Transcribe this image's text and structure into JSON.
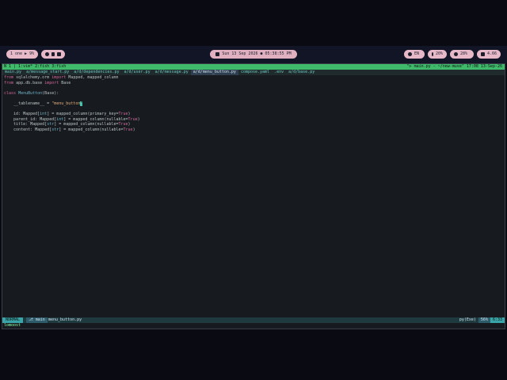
{
  "panel": {
    "workspace_label": "1 one ▶ 9%",
    "clock": "Sun 13 Sep 2026 ● 05:38:55 PM",
    "indicators": [
      "EN",
      "20%",
      "28%",
      "4.66"
    ]
  },
  "tmux": {
    "left": "N 1 | 1:vim* 2:fish 3:fish",
    "right": "\"⊳ main.py - ~/new-muse\" 17:08 13-Sep-26"
  },
  "tabs": [
    {
      "label": "main.py",
      "active": false
    },
    {
      "label": "a/message_start.py",
      "active": false
    },
    {
      "label": "a/d/dependencies.py",
      "active": false
    },
    {
      "label": "a/d/user.py",
      "active": false
    },
    {
      "label": "a/d/message.py",
      "active": false
    },
    {
      "label": "a/d/menu_button.py",
      "active": true
    },
    {
      "label": "compose.yaml",
      "active": false
    },
    {
      "label": ".env",
      "active": false
    },
    {
      "label": "a/d/base.py",
      "active": false
    }
  ],
  "code_lines": [
    [
      {
        "t": "from ",
        "c": "kw"
      },
      {
        "t": "sqlalchemy.orm ",
        "c": ""
      },
      {
        "t": "import ",
        "c": "kw"
      },
      {
        "t": "Mapped, mapped_column",
        "c": ""
      }
    ],
    [
      {
        "t": "from ",
        "c": "kw"
      },
      {
        "t": "app.db.base ",
        "c": ""
      },
      {
        "t": "import ",
        "c": "kw"
      },
      {
        "t": "Base",
        "c": ""
      }
    ],
    [],
    [
      {
        "t": "class ",
        "c": "kw"
      },
      {
        "t": "MenuButton",
        "c": "cl"
      },
      {
        "t": "(Base):",
        "c": ""
      }
    ],
    [],
    [
      {
        "t": "    __tablename__ = ",
        "c": ""
      },
      {
        "t": "\"menu_button",
        "c": "st"
      },
      {
        "t": "\"",
        "c": "cursor"
      }
    ],
    [],
    [
      {
        "t": "    id: Mapped[",
        "c": ""
      },
      {
        "t": "int",
        "c": "cl"
      },
      {
        "t": "] = mapped_column(primary_key=",
        "c": ""
      },
      {
        "t": "True",
        "c": "kw"
      },
      {
        "t": ")",
        "c": ""
      }
    ],
    [
      {
        "t": "    parent_id: Mapped[",
        "c": ""
      },
      {
        "t": "int",
        "c": "cl"
      },
      {
        "t": "] = mapped_column(nullable=",
        "c": ""
      },
      {
        "t": "True",
        "c": "kw"
      },
      {
        "t": ")",
        "c": ""
      }
    ],
    [
      {
        "t": "    title: Mapped[",
        "c": ""
      },
      {
        "t": "str",
        "c": "cl"
      },
      {
        "t": "] = mapped_column(nullable=",
        "c": ""
      },
      {
        "t": "True",
        "c": "kw"
      },
      {
        "t": ")",
        "c": ""
      }
    ],
    [
      {
        "t": "    content: Mapped[",
        "c": ""
      },
      {
        "t": "str",
        "c": "cl"
      },
      {
        "t": "] = mapped_column(nullable=",
        "c": ""
      },
      {
        "t": "True",
        "c": "kw"
      },
      {
        "t": ")",
        "c": ""
      }
    ]
  ],
  "statusline": {
    "mode": "NORMAL",
    "branch": "main",
    "file": "menu_button.py",
    "filetype": "py(Exe)",
    "percent": "56%",
    "position": "6:33"
  },
  "cmdline": "lomoost"
}
